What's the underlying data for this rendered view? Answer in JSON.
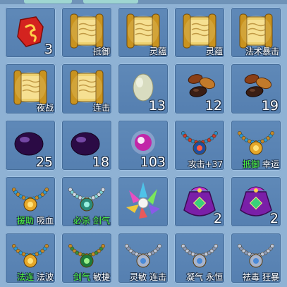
{
  "grid": {
    "rows": [
      [
        {
          "icon": "red-rune-stone-icon",
          "count": "3",
          "labels": []
        },
        {
          "icon": "golden-scroll-icon",
          "count": "",
          "labels": [
            {
              "text": "抵御",
              "green": false
            }
          ]
        },
        {
          "icon": "golden-scroll-icon",
          "count": "",
          "labels": [
            {
              "text": "灵蕴",
              "green": false
            }
          ]
        },
        {
          "icon": "golden-scroll-icon",
          "count": "",
          "labels": [
            {
              "text": "灵蕴",
              "green": false
            }
          ]
        },
        {
          "icon": "golden-scroll-icon",
          "count": "",
          "labels": [
            {
              "text": "法术暴击",
              "green": false
            }
          ]
        }
      ],
      [
        {
          "icon": "golden-scroll-icon",
          "count": "",
          "labels": [
            {
              "text": "夜战",
              "green": false
            }
          ]
        },
        {
          "icon": "golden-scroll-icon",
          "count": "",
          "labels": [
            {
              "text": "连击",
              "green": false
            }
          ]
        },
        {
          "icon": "pale-jade-orb-icon",
          "count": "13",
          "labels": []
        },
        {
          "icon": "brown-beans-icon",
          "count": "12",
          "labels": []
        },
        {
          "icon": "brown-beans-icon",
          "count": "19",
          "labels": []
        }
      ],
      [
        {
          "icon": "dark-purple-pearl-icon",
          "count": "25",
          "labels": []
        },
        {
          "icon": "dark-purple-pearl-icon",
          "count": "18",
          "labels": []
        },
        {
          "icon": "pink-glowing-orb-icon",
          "count": "103",
          "labels": []
        },
        {
          "icon": "blue-flame-necklace-icon",
          "count": "",
          "labels": [
            {
              "text": "攻击+37",
              "green": false
            }
          ]
        },
        {
          "icon": "gold-medallion-necklace-icon",
          "count": "",
          "labels": [
            {
              "text": "抵御",
              "green": true
            },
            {
              "text": "幸运",
              "green": false
            }
          ]
        }
      ],
      [
        {
          "icon": "gold-medallion-necklace-icon",
          "count": "",
          "labels": [
            {
              "text": "援助",
              "green": true
            },
            {
              "text": "吸血",
              "green": false
            }
          ]
        },
        {
          "icon": "crystal-necklace-icon",
          "count": "",
          "labels": [
            {
              "text": "必杀",
              "green": true
            },
            {
              "text": "剑气",
              "green": true
            }
          ]
        },
        {
          "icon": "crystal-cluster-icon",
          "count": "",
          "labels": []
        },
        {
          "icon": "purple-pouch-icon",
          "count": "2",
          "labels": []
        },
        {
          "icon": "purple-pouch-icon",
          "count": "2",
          "labels": []
        }
      ],
      [
        {
          "icon": "gold-medallion-necklace-icon",
          "count": "",
          "labels": [
            {
              "text": "法连",
              "green": true
            },
            {
              "text": "法波",
              "green": false
            }
          ]
        },
        {
          "icon": "jade-ring-necklace-icon",
          "count": "",
          "labels": [
            {
              "text": "剑气",
              "green": true
            },
            {
              "text": "敏捷",
              "green": false
            }
          ]
        },
        {
          "icon": "silver-chain-necklace-icon",
          "count": "",
          "labels": [
            {
              "text": "灵敏",
              "green": false
            },
            {
              "text": "连击",
              "green": false
            }
          ]
        },
        {
          "icon": "silver-chain-necklace-icon",
          "count": "",
          "labels": [
            {
              "text": "凝气",
              "green": false
            },
            {
              "text": "永恒",
              "green": false
            }
          ]
        },
        {
          "icon": "silver-chain-necklace-icon",
          "count": "",
          "labels": [
            {
              "text": "祛毒",
              "green": false
            },
            {
              "text": "狂暴",
              "green": false
            }
          ]
        }
      ]
    ]
  }
}
